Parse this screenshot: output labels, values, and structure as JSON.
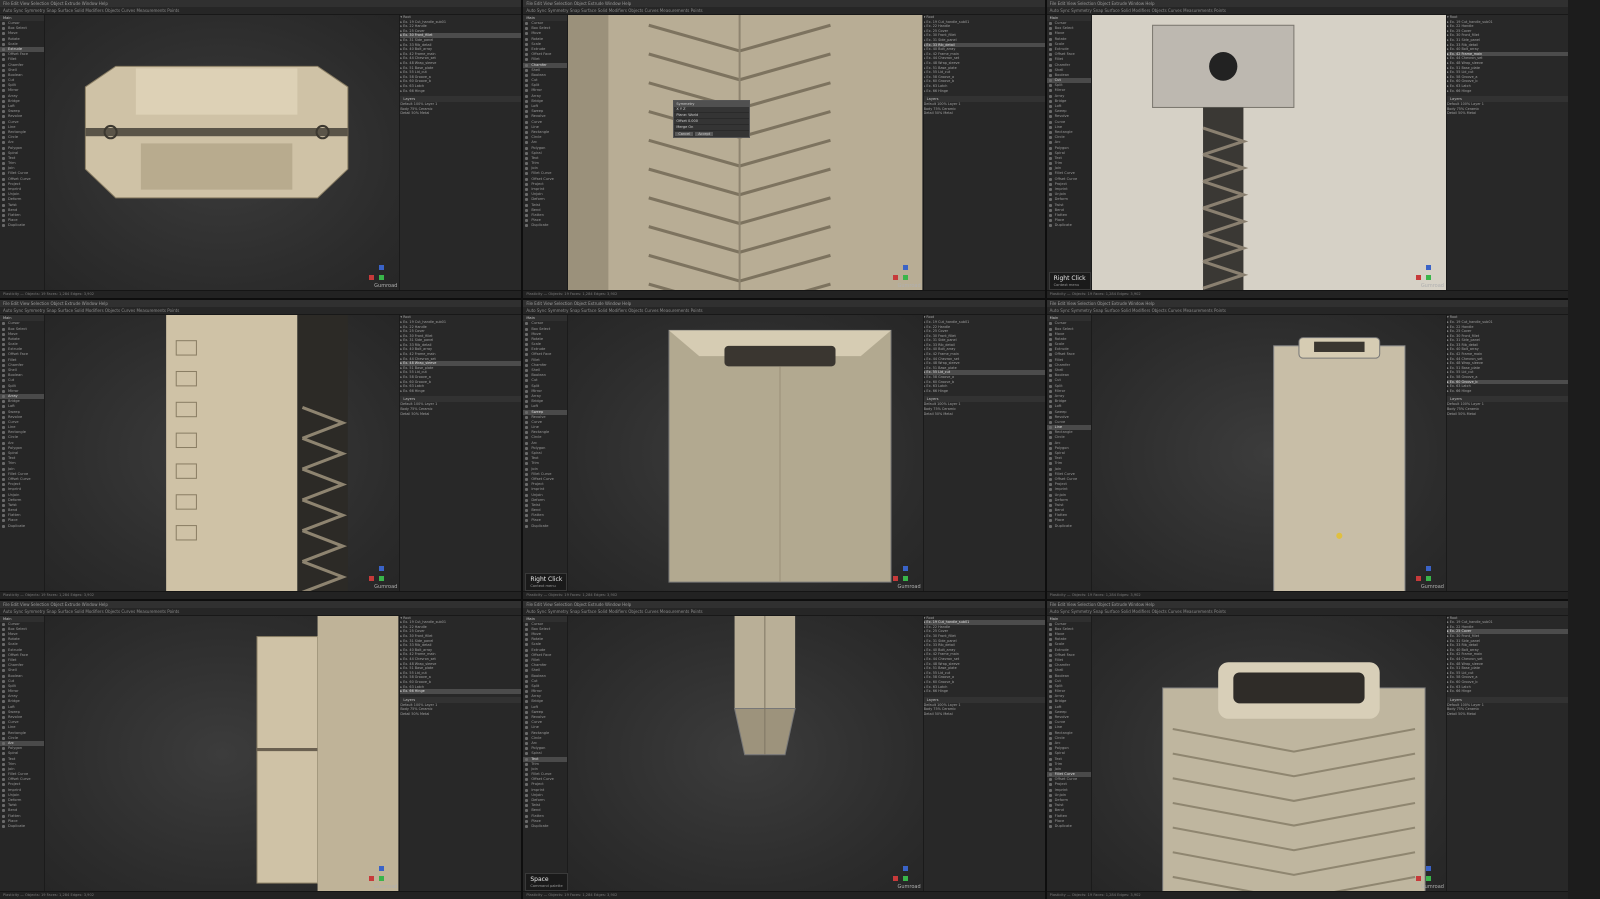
{
  "window": {
    "title": "Plasticity"
  },
  "menubar": [
    "File",
    "Edit",
    "View",
    "Selection",
    "Object",
    "Extrude",
    "Window",
    "Help"
  ],
  "toolbar": [
    "Auto Sync",
    "Symmetry",
    "Snap",
    "Surface",
    "Solid",
    "Modifiers",
    "Objects",
    "Curves",
    "Measurements",
    "Points"
  ],
  "tools_header": "Main",
  "tools": [
    "Cursor",
    "Box Select",
    "Move",
    "Rotate",
    "Scale",
    "Extrude",
    "Offset Face",
    "Fillet",
    "Chamfer",
    "Shell",
    "Boolean",
    "Cut",
    "Split",
    "Mirror",
    "Array",
    "Bridge",
    "Loft",
    "Sweep",
    "Revolve",
    "Curve",
    "Line",
    "Rectangle",
    "Circle",
    "Arc",
    "Polygon",
    "Spiral",
    "Text",
    "Trim",
    "Join",
    "Fillet Curve",
    "Offset Curve",
    "Project",
    "Imprint",
    "Unjoin",
    "Deform",
    "Twist",
    "Bend",
    "Flatten",
    "Place",
    "Duplicate"
  ],
  "outliner_rows": [
    "▾ Root",
    "  ▸ Ex. 19 Cut_handle_sub01",
    "  ▸ Ex. 22 Handle",
    "  ▸ Ex. 25 Cover",
    "  ▸ Ex. 30 Front_fillet",
    "  ▸ Ex. 31 Side_panel",
    "  ▸ Ex. 33 Rib_detail",
    "  ▸ Ex. 40 Bolt_array",
    "  ▸ Ex. 42 Frame_main",
    "  ▸ Ex. 44 Chevron_set",
    "  ▸ Ex. 48 Wrap_sleeve",
    "  ▸ Ex. 51 Base_plate",
    "  ▸ Ex. 55 Lid_cut",
    "  ▸ Ex. 58 Groove_a",
    "  ▸ Ex. 60 Groove_b",
    "  ▸ Ex. 63 Latch",
    "  ▸ Ex. 66 Hinge"
  ],
  "outliner_panel": "Layers",
  "layer_rows": [
    "Default  100%  Layer 1",
    "Body  75%  Ceramic",
    "Detail  50%  Metal"
  ],
  "status": "Plasticity — Objects: 19  Faces: 1,284  Edges: 3,902",
  "brand": "Gumroad",
  "popups": [
    {
      "title": "Right Click",
      "sub": "Context menu"
    },
    {
      "title": "Right Click",
      "sub": "Context menu"
    },
    {
      "title": "Space",
      "sub": "Command palette"
    }
  ],
  "dialog": {
    "title": "Symmetry",
    "rows": [
      "X  Y  Z",
      "Plane: World",
      "Offset  0.000",
      "Merge  On"
    ],
    "buttons": [
      "Cancel",
      "Accept"
    ]
  },
  "colors": {
    "model": "#cfc2a6",
    "model_dark": "#a89b7f",
    "background": "#2b2b2b",
    "accent_red": "#c73a3a",
    "accent_green": "#39b54a",
    "accent_blue": "#3a63c7"
  },
  "panes": [
    {
      "id": "p1",
      "model": "crate-top"
    },
    {
      "id": "p2",
      "model": "chevron-panel",
      "has_dialog": true
    },
    {
      "id": "p3",
      "model": "hammer-head",
      "popup": 0
    },
    {
      "id": "p4",
      "model": "side-detail"
    },
    {
      "id": "p5",
      "model": "box-front",
      "popup": 1
    },
    {
      "id": "p6",
      "model": "box-slim"
    },
    {
      "id": "p7",
      "model": "hinge-closeup"
    },
    {
      "id": "p8",
      "model": "leg-bottom",
      "popup": 2
    },
    {
      "id": "p9",
      "model": "case-front"
    }
  ]
}
